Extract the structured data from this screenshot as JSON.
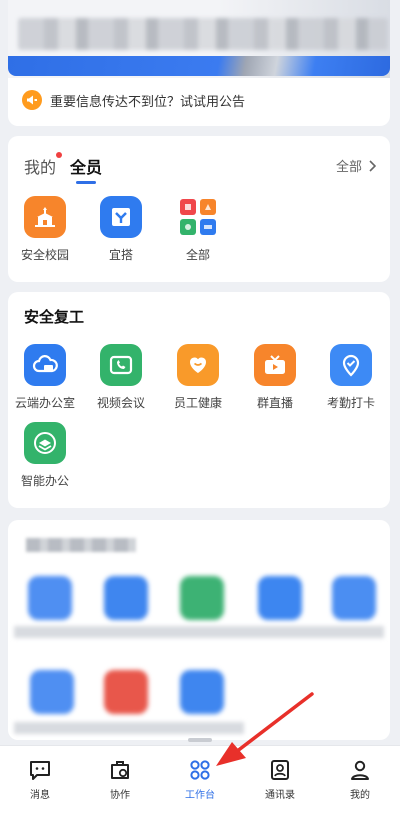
{
  "notice": {
    "text": "重要信息传达不到位？试试用公告"
  },
  "my_apps": {
    "tab_mine": "我的",
    "tab_all": "全员",
    "all_link": "全部",
    "items": [
      {
        "label": "安全校园",
        "icon": "campus-icon",
        "color": "#f7852b"
      },
      {
        "label": "宜搭",
        "icon": "yida-icon",
        "color": "#2f7bef"
      },
      {
        "label": "全部",
        "icon": "grid-icon",
        "color": "#ffffff"
      }
    ]
  },
  "safe_return": {
    "title": "安全复工",
    "items": [
      {
        "label": "云端办公室",
        "icon": "cloud-office-icon",
        "color": "#2f7bef"
      },
      {
        "label": "视频会议",
        "icon": "video-call-icon",
        "color": "#33b36b"
      },
      {
        "label": "员工健康",
        "icon": "heart-icon",
        "color": "#f99a2a"
      },
      {
        "label": "群直播",
        "icon": "live-tv-icon",
        "color": "#f7852b"
      },
      {
        "label": "考勤打卡",
        "icon": "location-check-icon",
        "color": "#3d8af5"
      },
      {
        "label": "智能办公",
        "icon": "smart-office-icon",
        "color": "#33b36b"
      }
    ]
  },
  "bottom_nav": {
    "items": [
      {
        "label": "消息",
        "icon": "message-icon",
        "active": false
      },
      {
        "label": "协作",
        "icon": "collaboration-icon",
        "active": false
      },
      {
        "label": "工作台",
        "icon": "workbench-icon",
        "active": true
      },
      {
        "label": "通讯录",
        "icon": "contacts-icon",
        "active": false
      },
      {
        "label": "我的",
        "icon": "profile-icon",
        "active": false
      }
    ]
  },
  "colors": {
    "accent": "#2f6fe6",
    "arrow": "#e8302a"
  }
}
